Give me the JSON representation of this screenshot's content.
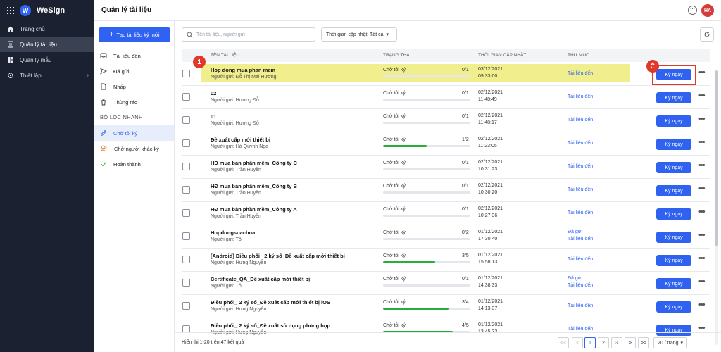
{
  "app": {
    "name": "WeSign",
    "logo_letter": "W"
  },
  "nav": {
    "items": [
      {
        "label": "Trang chủ",
        "icon": "home-icon"
      },
      {
        "label": "Quản lý tài liệu",
        "icon": "document-icon"
      },
      {
        "label": "Quản lý mẫu",
        "icon": "template-icon"
      },
      {
        "label": "Thiết lập",
        "icon": "gear-icon"
      }
    ],
    "active_index": 1,
    "settings_chevron": "›"
  },
  "header": {
    "title": "Quản lý tài liệu",
    "more_icon": "⋯",
    "avatar_initials": "HA"
  },
  "side": {
    "create_label": "Tạo tài liệu ký mới",
    "folders": [
      {
        "label": "Tài liệu đến",
        "icon": "inbox-icon"
      },
      {
        "label": "Đã gửi",
        "icon": "send-icon"
      },
      {
        "label": "Nháp",
        "icon": "draft-icon"
      },
      {
        "label": "Thùng rác",
        "icon": "trash-icon"
      }
    ],
    "quick_filter_title": "BỘ LỌC NHANH",
    "filters": [
      {
        "label": "Chờ tôi ký",
        "icon": "pen-icon"
      },
      {
        "label": "Chờ người khác ký",
        "icon": "users-icon"
      },
      {
        "label": "Hoàn thành",
        "icon": "check-icon"
      }
    ],
    "active_filter_index": 0
  },
  "toolbar": {
    "search_placeholder": "Tên tài liệu, người gửi",
    "time_filter": "Thời gian cập nhật: Tất cả",
    "time_filter_chevron": "▾"
  },
  "table": {
    "columns": [
      "TÊN TÀI LIỆU",
      "TRẠNG THÁI",
      "THỜI GIAN CẬP NHẬT",
      "THƯ MỤC"
    ],
    "sign_label": "Ký ngay",
    "more_label": "•••",
    "rows": [
      {
        "name": "Hop dong mua phan mem",
        "sender": "Người gửi: Đỗ Thị Mai Hương",
        "status": "Chờ tôi ký",
        "count": "0/1",
        "progress": 0,
        "date": "03/12/2021",
        "time": "09:33:00",
        "folders": [
          "Tài liệu đến"
        ]
      },
      {
        "name": "02",
        "sender": "Người gửi: Hương Đỗ",
        "status": "Chờ tôi ký",
        "count": "0/1",
        "progress": 0,
        "date": "02/12/2021",
        "time": "11:48:49",
        "folders": [
          "Tài liệu đến"
        ]
      },
      {
        "name": "01",
        "sender": "Người gửi: Hương Đỗ",
        "status": "Chờ tôi ký",
        "count": "0/1",
        "progress": 0,
        "date": "02/12/2021",
        "time": "11:48:17",
        "folders": [
          "Tài liệu đến"
        ]
      },
      {
        "name": "Đề xuất cấp mới thiết bị",
        "sender": "Người gửi: Hà Quỳnh Nga",
        "status": "Chờ tôi ký",
        "count": "1/2",
        "progress": 0.5,
        "date": "02/12/2021",
        "time": "11:23:05",
        "folders": [
          "Tài liệu đến"
        ]
      },
      {
        "name": "HĐ mua bản phần mềm_Công ty C",
        "sender": "Người gửi: Trần Huyền",
        "status": "Chờ tôi ký",
        "count": "0/1",
        "progress": 0,
        "date": "02/12/2021",
        "time": "10:31:23",
        "folders": [
          "Tài liệu đến"
        ]
      },
      {
        "name": "HĐ mua bản phần mềm_Công ty B",
        "sender": "Người gửi: Trần Huyền",
        "status": "Chờ tôi ký",
        "count": "0/1",
        "progress": 0,
        "date": "02/12/2021",
        "time": "10:30:20",
        "folders": [
          "Tài liệu đến"
        ]
      },
      {
        "name": "HĐ mua bản phần mềm_Công ty A",
        "sender": "Người gửi: Trần Huyền",
        "status": "Chờ tôi ký",
        "count": "0/1",
        "progress": 0,
        "date": "02/12/2021",
        "time": "10:27:36",
        "folders": [
          "Tài liệu đến"
        ]
      },
      {
        "name": "Hopdongsuachua",
        "sender": "Người gửi: Tôi",
        "status": "Chờ tôi ký",
        "count": "0/2",
        "progress": 0,
        "date": "01/12/2021",
        "time": "17:30:40",
        "folders": [
          "Đã gửi",
          "Tài liệu đến"
        ]
      },
      {
        "name": "[Android] Điều phối_ 2 ký số_Đề xuất cấp mới thiết bị",
        "sender": "Người gửi: Hưng Nguyễn",
        "status": "Chờ tôi ký",
        "count": "3/5",
        "progress": 0.6,
        "date": "01/12/2021",
        "time": "15:58:13",
        "folders": [
          "Tài liệu đến"
        ]
      },
      {
        "name": "Certificate_QA_Đề xuất cấp mới thiết bị",
        "sender": "Người gửi: Tôi",
        "status": "Chờ tôi ký",
        "count": "0/1",
        "progress": 0,
        "date": "01/12/2021",
        "time": "14:38:33",
        "folders": [
          "Đã gửi",
          "Tài liệu đến"
        ]
      },
      {
        "name": "Điều phối_ 2 ký số_Đề xuất cấp mới thiết bị iOS",
        "sender": "Người gửi: Hưng Nguyễn",
        "status": "Chờ tôi ký",
        "count": "3/4",
        "progress": 0.75,
        "date": "01/12/2021",
        "time": "14:13:37",
        "folders": [
          "Tài liệu đến"
        ]
      },
      {
        "name": "Điều phối_ 2 ký số_Đề xuất sử dụng phòng họp",
        "sender": "Người gửi: Hưng Nguyễn",
        "status": "Chờ tôi ký",
        "count": "4/5",
        "progress": 0.8,
        "date": "01/12/2021",
        "time": "13:45:33",
        "folders": [
          "Tài liệu đến"
        ]
      }
    ]
  },
  "annotations": {
    "marker1": "1",
    "marker2": "2"
  },
  "footer": {
    "summary": "Hiển thị 1-20 trên 47 kết quả",
    "first": "<<",
    "prev": "<",
    "pages": [
      "1",
      "2",
      "3"
    ],
    "current_page": "1",
    "next": ">",
    "last": ">>",
    "page_size": "20 / trang",
    "page_size_chevron": "▾"
  },
  "colors": {
    "primary": "#2f62f0",
    "sidebar_bg": "#1b2130",
    "highlight": "#f1ee8e",
    "annotation": "#e0392b",
    "progress": "#27ae3a"
  }
}
